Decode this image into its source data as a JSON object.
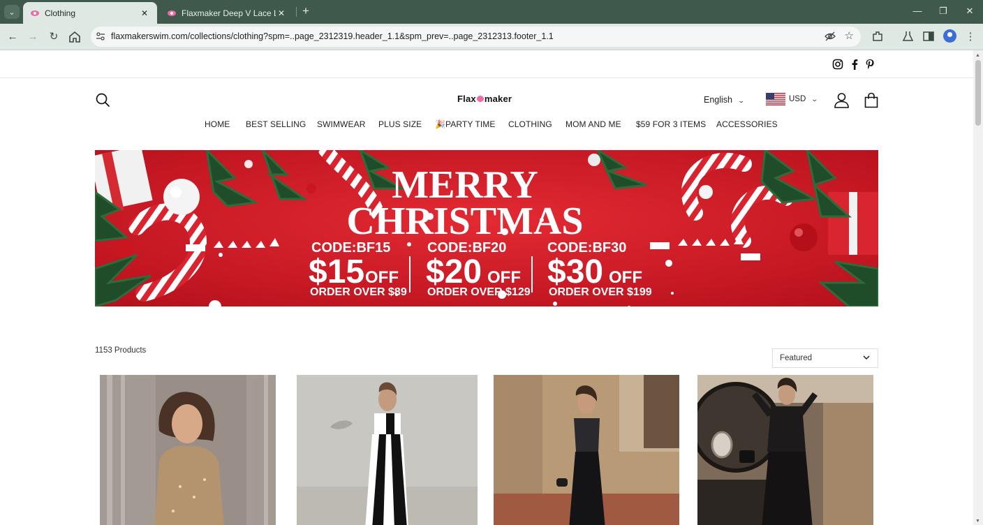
{
  "browser": {
    "tabs": [
      {
        "title": "Clothing",
        "active": true
      },
      {
        "title": "Flaxmaker Deep V Lace Long Sle...",
        "active": false
      }
    ],
    "url": "flaxmakerswim.com/collections/clothing?spm=..page_2312319.header_1.1&spm_prev=..page_2312313.footer_1.1"
  },
  "header": {
    "logo_left": "Flax",
    "logo_right": "maker",
    "language": "English",
    "currency": "USD",
    "social_icons": [
      "instagram-icon",
      "facebook-icon",
      "pinterest-icon"
    ]
  },
  "nav": {
    "items": [
      "HOME",
      "BEST SELLING",
      "SWIMWEAR",
      "PLUS SIZE",
      "🎉PARTY TIME",
      "CLOTHING",
      "MOM AND ME",
      "$59 FOR 3 ITEMS",
      "ACCESSORIES"
    ]
  },
  "banner": {
    "line1": "MERRY",
    "line2": "CHRISTMAS",
    "offers": [
      {
        "code": "CODE:BF15",
        "amount": "$15",
        "suffix": "OFF",
        "condition": "ORDER OVER $89"
      },
      {
        "code": "CODE:BF20",
        "amount": "$20",
        "suffix": "OFF",
        "condition": "ORDER OVER $129"
      },
      {
        "code": "CODE:BF30",
        "amount": "$30",
        "suffix": "OFF",
        "condition": "ORDER OVER $199"
      }
    ]
  },
  "collection": {
    "count_label": "1153 Products",
    "sort_label": "Featured"
  },
  "colors": {
    "chrome": "#3f5a4c",
    "toolbar": "#dfe8e3",
    "banner_red": "#cf1f2c",
    "brand_pink": "#f06aa5"
  }
}
